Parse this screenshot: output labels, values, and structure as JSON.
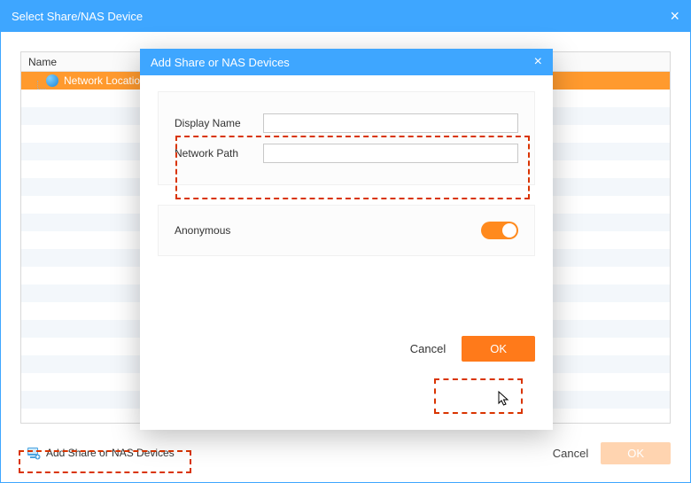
{
  "outer": {
    "title": "Select Share/NAS Device",
    "close_label": "×",
    "tree_header": "Name",
    "tree_selected_label": "Network Location",
    "add_button_label": "Add Share or NAS Devices",
    "cancel_label": "Cancel",
    "ok_label": "OK"
  },
  "modal": {
    "title": "Add Share or NAS Devices",
    "close_label": "×",
    "display_name_label": "Display Name",
    "display_name_value": "",
    "network_path_label": "Network Path",
    "network_path_value": "",
    "anonymous_label": "Anonymous",
    "anonymous_on": true,
    "cancel_label": "Cancel",
    "ok_label": "OK"
  },
  "colors": {
    "accent_blue": "#3ea6ff",
    "accent_orange": "#ff7a1a",
    "highlight_red": "#d93400"
  }
}
